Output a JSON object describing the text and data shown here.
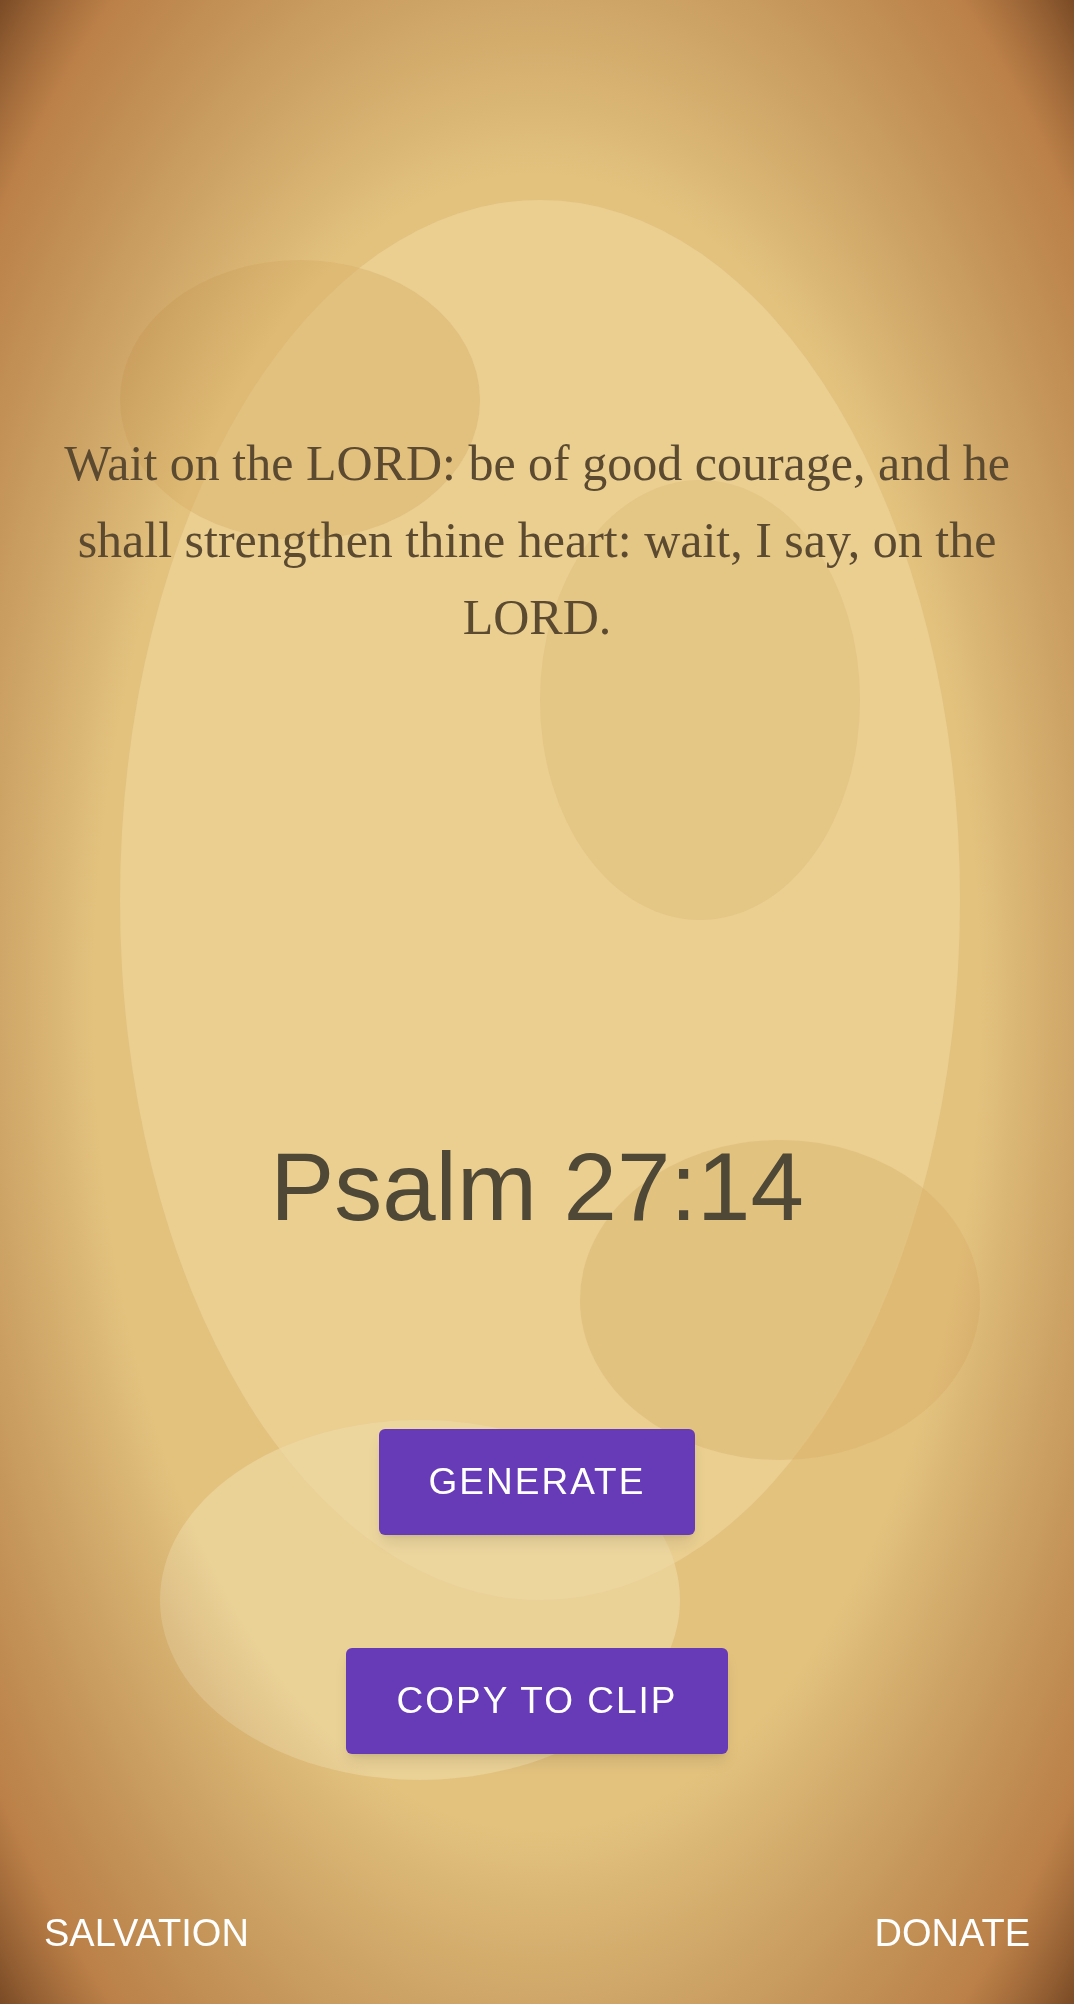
{
  "verse": "Wait on the LORD: be of good courage, and he shall strengthen thine heart: wait, I say, on the LORD.",
  "reference": "Psalm 27:14",
  "buttons": [
    "GENERATE",
    "COPY TO CLIP"
  ],
  "footer": {
    "left": "SALVATION",
    "right": "DONATE"
  }
}
